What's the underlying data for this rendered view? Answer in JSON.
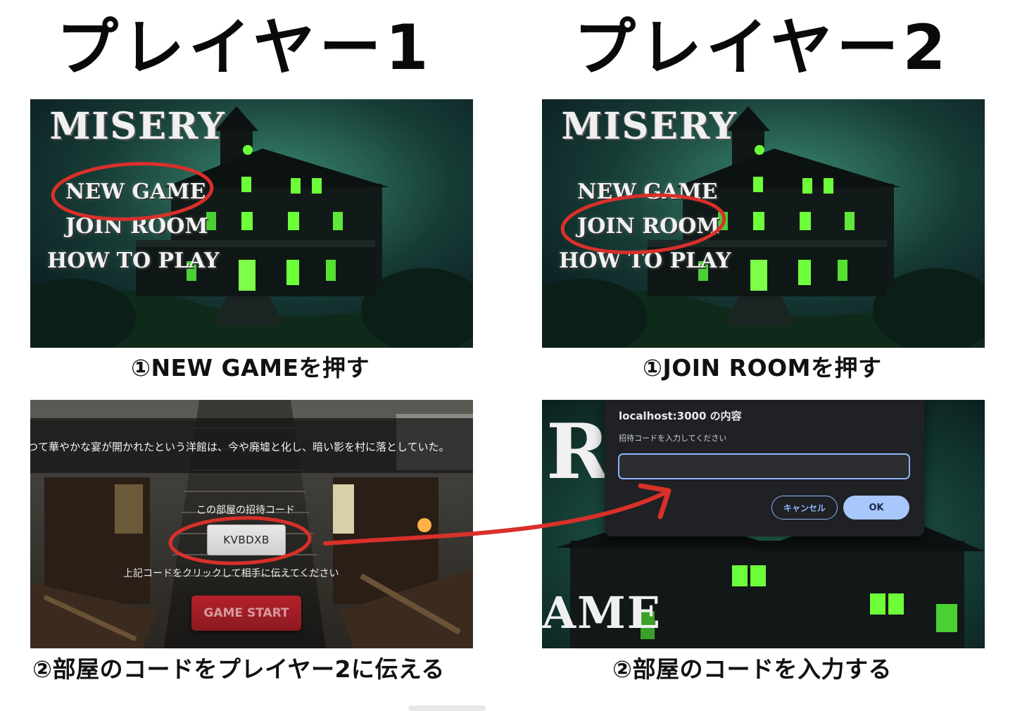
{
  "headings": {
    "player1": "プレイヤー1",
    "player2": "プレイヤー2"
  },
  "title_screen": {
    "logo": "MISERY",
    "menu": {
      "new_game": "NEW GAME",
      "join_room": "JOIN ROOM",
      "how_to_play": "HOW TO PLAY"
    }
  },
  "captions": {
    "p1_step1": "①NEW  GAMEを押す",
    "p2_step1": "①JOIN  ROOMを押す",
    "p1_step2": "②部屋のコードをプレイヤー2に伝える",
    "p2_step2": "②部屋のコードを入力する"
  },
  "lobby": {
    "story": "つて華やかな宴が開かれたという洋館は、今や廃墟と化し、暗い影を村に落としていた。",
    "code_label": "この部屋の招待コード",
    "code": "KVBDXB",
    "copy_hint": "上記コードをクリックして相手に伝えてください",
    "start_button": "GAME START"
  },
  "join_dialog": {
    "background_letter": "R",
    "background_word": "AME",
    "title": "localhost:3000 の内容",
    "message": "招待コードを入力してください",
    "input_value": "",
    "cancel_label": "キャンセル",
    "ok_label": "OK"
  },
  "colors": {
    "annotation_red": "#d9302a",
    "window_glow": "#6dff3a",
    "dialog_bg": "#1f2124",
    "dialog_accent": "#8ab4f8",
    "start_button": "#a81e26"
  }
}
